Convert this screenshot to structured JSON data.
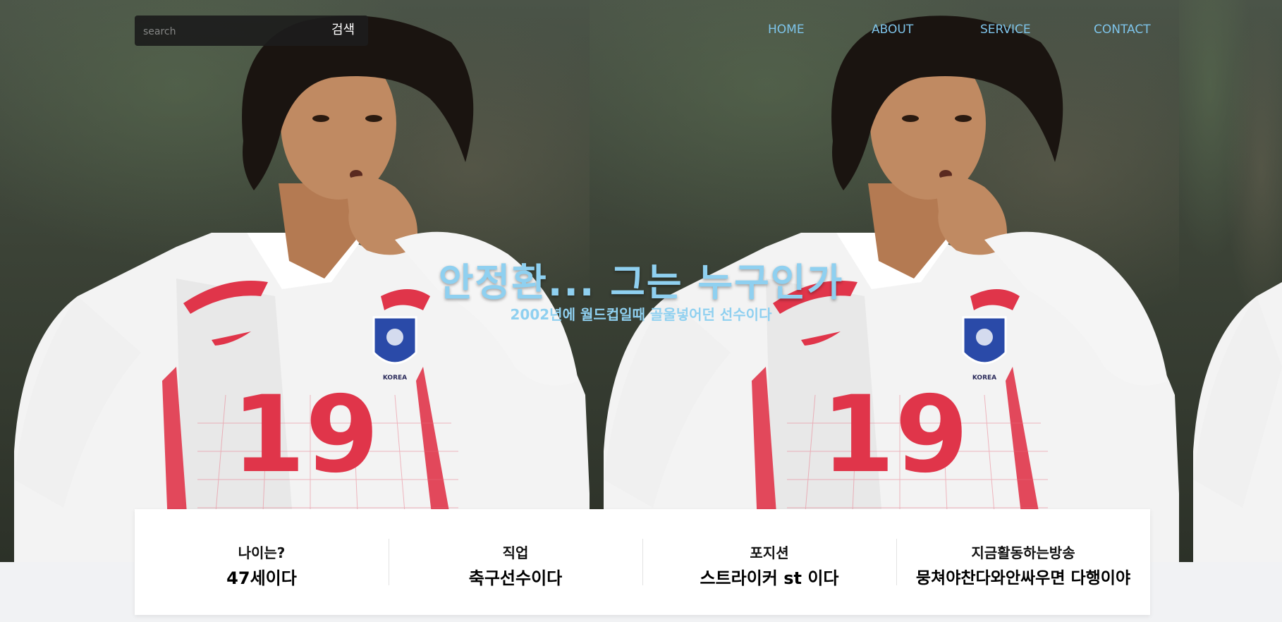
{
  "search": {
    "placeholder": "search",
    "button_label": "검색"
  },
  "nav": {
    "items": [
      "HOME",
      "ABOUT",
      "SERVICE",
      "CONTACT"
    ]
  },
  "hero": {
    "title": "안정환... 그는 누구인가",
    "subtitle": "2002년에 월드컵일때 골울넣어던 선수이다",
    "jersey_number": "19",
    "badge_text": "KOREA"
  },
  "info": [
    {
      "label": "나이는?",
      "value": "47세이다"
    },
    {
      "label": "직업",
      "value": "축구선수이다"
    },
    {
      "label": "포지션",
      "value": "스트라이커 st 이다"
    },
    {
      "label": "지금활동하는방송",
      "value": "뭉쳐야찬다와안싸우면 다행이야"
    }
  ],
  "colors": {
    "accent": "#8fd0f0",
    "nav": "#7ec4ea",
    "jersey_red": "#e0354a"
  }
}
